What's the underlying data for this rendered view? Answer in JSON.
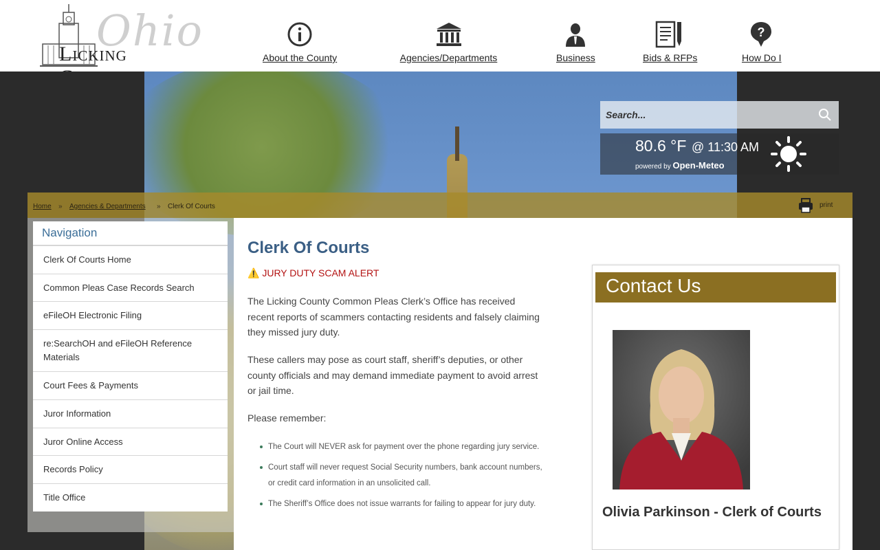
{
  "header": {
    "logo_word_ohio": "Ohio",
    "logo_word_county": "Licking County",
    "nav": [
      {
        "label": "About the County",
        "icon": "info-icon"
      },
      {
        "label": "Agencies/Departments",
        "icon": "building-icon"
      },
      {
        "label": "Business",
        "icon": "businessman-icon"
      },
      {
        "label": "Bids & RFPs",
        "icon": "document-pen-icon"
      },
      {
        "label": "How Do I",
        "icon": "question-icon"
      }
    ]
  },
  "search": {
    "placeholder": "Search..."
  },
  "weather": {
    "temp": "80.6 °F",
    "time": "@ 11:30 AM",
    "powered_by": "powered by",
    "provider": "Open-Meteo",
    "condition_icon": "sun-icon"
  },
  "breadcrumb": {
    "home": "Home",
    "sep": "»",
    "agencies": "Agencies & Departments",
    "current": "Clerk Of Courts",
    "print": "print"
  },
  "sidenav": {
    "heading": "Navigation",
    "items": [
      "Clerk Of Courts Home",
      "Common Pleas Case Records Search",
      "eFileOH Electronic Filing",
      "re:SearchOH and eFileOH Reference Materials",
      "Court Fees & Payments",
      "Juror Information",
      "Juror Online Access",
      "Records Policy",
      "Title Office"
    ]
  },
  "main": {
    "title": "Clerk Of Courts",
    "alert_icon": "⚠️",
    "alert": "JURY DUTY SCAM ALERT",
    "para1": "The Licking County Common Pleas Clerk’s Office has received recent reports of scammers contacting residents and falsely claiming they missed jury duty.",
    "para2": "These callers may pose as court staff, sheriff’s deputies, or other county officials and may demand immediate payment to avoid arrest or jail time.",
    "para3": "Please remember:",
    "bullets": [
      "The Court will NEVER ask for payment over the phone regarding jury service.",
      "Court staff will never request Social Security numbers, bank account numbers, or credit card information in an unsolicited call.",
      "The Sheriff’s Office does not issue warrants for failing to appear for jury duty."
    ]
  },
  "contact": {
    "heading": "Contact Us",
    "name": "Olivia Parkinson - Clerk of Courts"
  },
  "colors": {
    "gold_bar": "#8b6f22",
    "title_blue": "#3b5f85",
    "alert_red": "#b31212"
  }
}
